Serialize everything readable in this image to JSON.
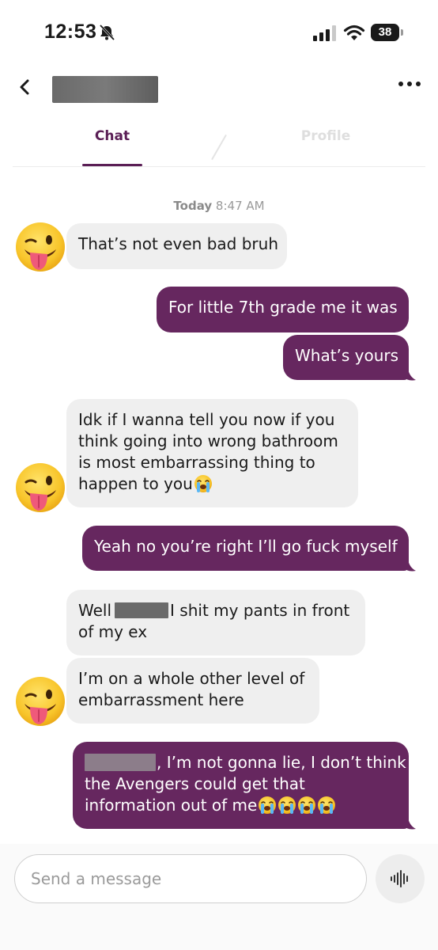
{
  "status_bar": {
    "time": "12:53",
    "battery": "38"
  },
  "tabs": [
    {
      "label": "Chat",
      "active": true
    },
    {
      "label": "Profile",
      "active": false
    }
  ],
  "timestamp": {
    "day": "Today",
    "time": "8:47 AM"
  },
  "messages": [
    {
      "from": "them",
      "lines": [
        "That’s not even bad bruh"
      ]
    },
    {
      "from": "me",
      "lines": [
        "For little 7th grade me it was"
      ]
    },
    {
      "from": "me",
      "lines": [
        "What’s yours"
      ]
    },
    {
      "from": "them",
      "lines": [
        "Idk if I wanna tell you now if you",
        "think going into wrong bathroom",
        "is most embarrassing thing to",
        "happen to you"
      ],
      "emoji": "loudly-crying-face"
    },
    {
      "from": "me",
      "lines": [
        "Yeah no you’re right I’ll go fuck myself"
      ]
    },
    {
      "from": "them",
      "lines": [
        "Well",
        "I shit my pants in front",
        "of my ex"
      ],
      "redacted_name": true
    },
    {
      "from": "them",
      "lines": [
        "I’m on a whole other level of",
        "embarrassment here"
      ]
    },
    {
      "from": "me",
      "lines": [
        ", I’m not gonna lie, I don’t think",
        "the Avengers could get that",
        "information out of me"
      ],
      "redacted_name": true,
      "emoji": "loudly-crying-face",
      "emoji_count": 4
    }
  ],
  "composer": {
    "placeholder": "Send a message"
  },
  "colors": {
    "accent": "#5a1e55",
    "outgoing_bubble": "#66275f",
    "incoming_bubble": "#efefef"
  },
  "icons": [
    "back-icon",
    "more-icon",
    "bell-slash-icon",
    "voice-icon",
    "winking-tongue-emoji-avatar",
    "loudly-crying-face-emoji"
  ]
}
